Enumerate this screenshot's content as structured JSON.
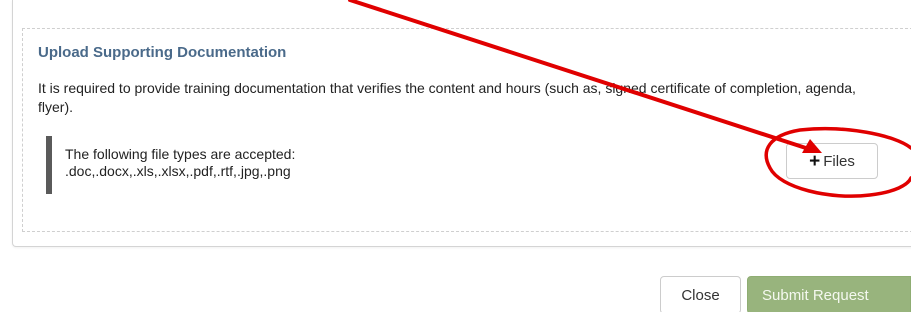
{
  "upload": {
    "title": "Upload Supporting Documentation",
    "description": "It is required to provide training documentation that verifies the content and hours (such as, signed certificate of completion, agenda, flyer).",
    "accepted_label": "The following file types are accepted:",
    "accepted_types": ".doc,.docx,.xls,.xlsx,.pdf,.rtf,.jpg,.png",
    "files_button": {
      "icon": "plus-icon",
      "icon_glyph": "+",
      "label": "Files"
    }
  },
  "footer": {
    "close_label": "Close",
    "submit_label": "Submit Request"
  },
  "colors": {
    "title": "#4a6a8a",
    "submit_bg": "#98b47d",
    "annotation": "#e00000"
  }
}
